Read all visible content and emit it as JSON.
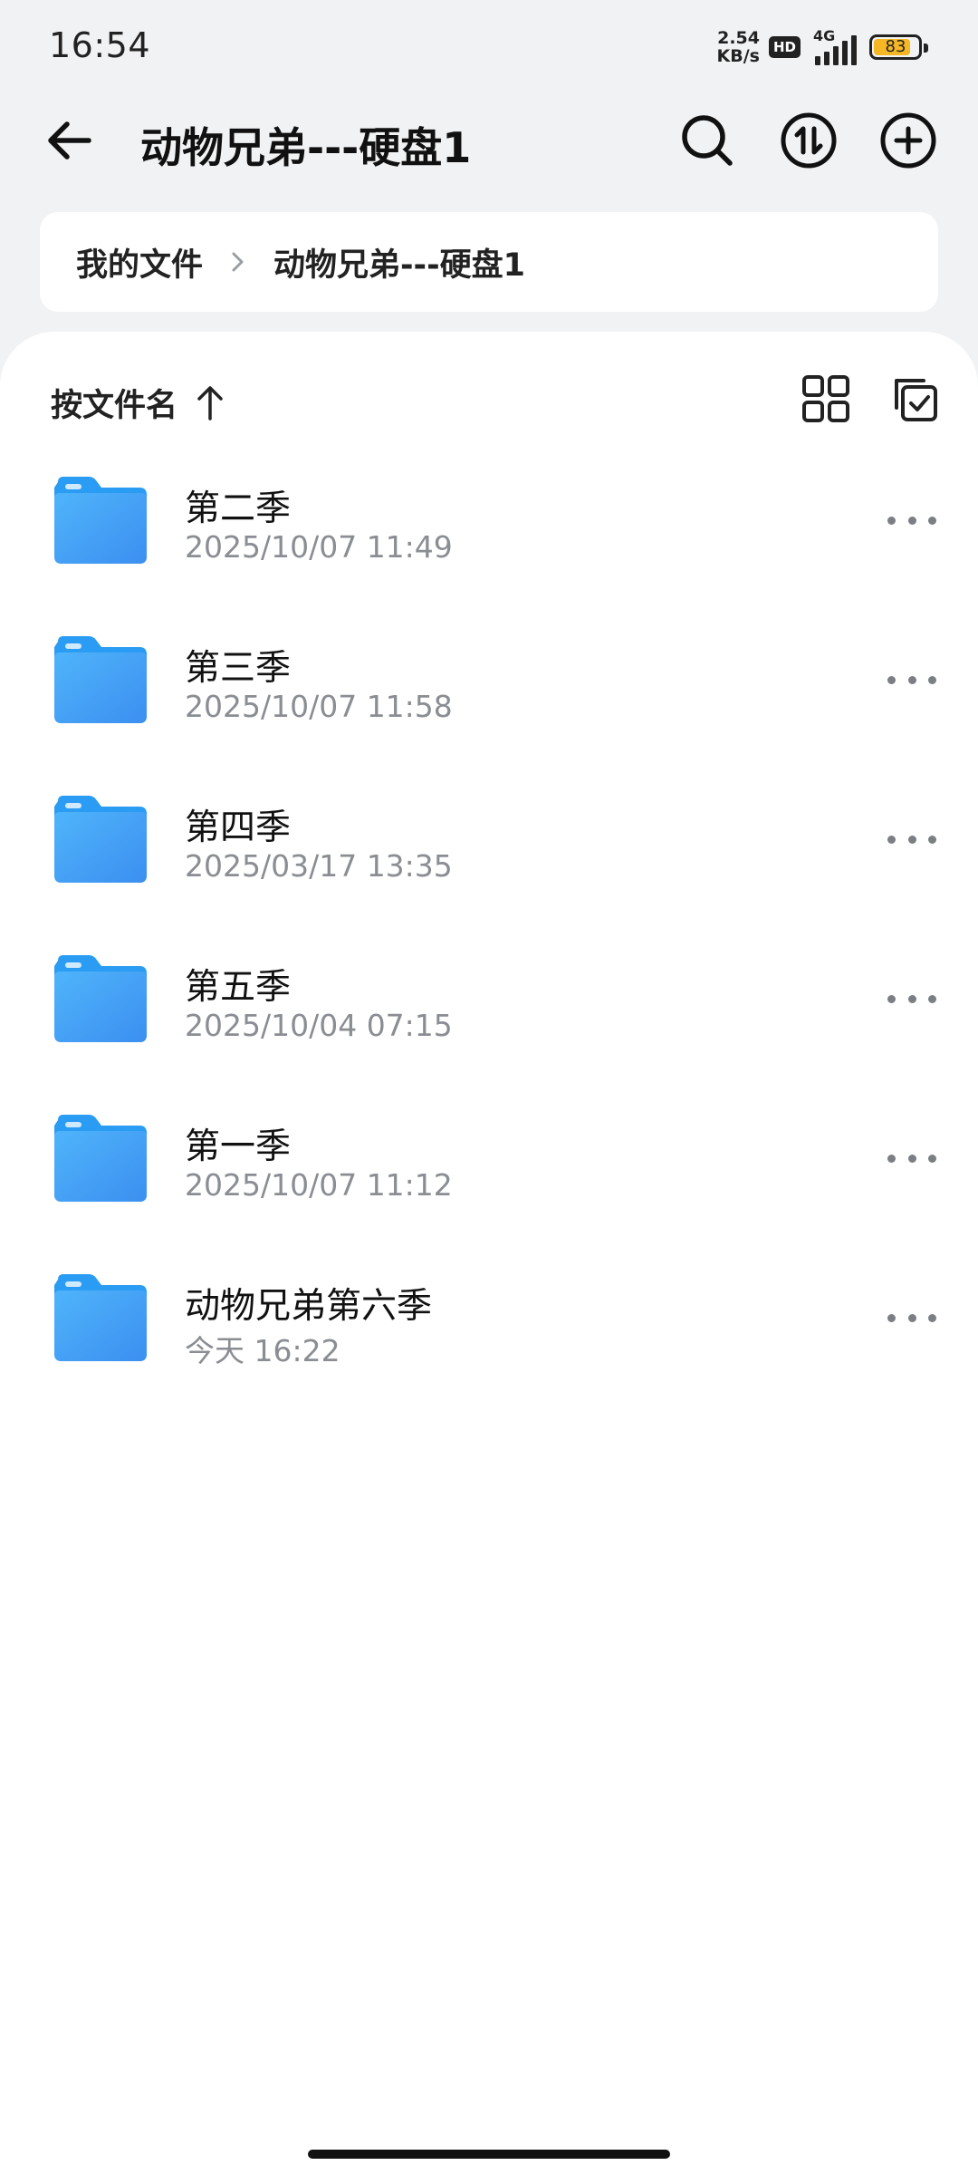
{
  "status_bar": {
    "time": "16:54",
    "net_speed_value": "2.54",
    "net_speed_unit": "KB/s",
    "hd_label": "HD",
    "network_label": "4G",
    "battery_percent": "83",
    "battery_color": "#f5b724"
  },
  "header": {
    "title": "动物兄弟---硬盘1",
    "icons": [
      "back-arrow-icon",
      "search-icon",
      "transfer-icon",
      "add-icon"
    ]
  },
  "breadcrumb": {
    "items": [
      "我的文件",
      "动物兄弟---硬盘1"
    ]
  },
  "toolbar": {
    "sort_label": "按文件名",
    "sort_direction": "ascending"
  },
  "files": [
    {
      "name": "第二季",
      "date": "2025/10/07 11:49"
    },
    {
      "name": "第三季",
      "date": "2025/10/07 11:58"
    },
    {
      "name": "第四季",
      "date": "2025/03/17 13:35"
    },
    {
      "name": "第五季",
      "date": "2025/10/04 07:15"
    },
    {
      "name": "第一季",
      "date": "2025/10/07 11:12"
    },
    {
      "name": "动物兄弟第六季",
      "date": "今天 16:22"
    }
  ],
  "colors": {
    "folder_blue": "#3fa6f5",
    "background": "#f1f2f4"
  }
}
